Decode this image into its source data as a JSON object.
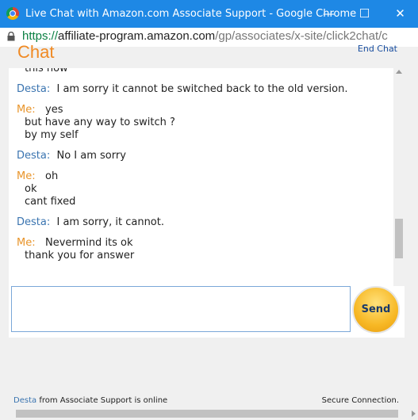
{
  "window": {
    "title": "Live Chat with Amazon.com Associate Support - Google Chrome",
    "minimize": "—",
    "maximize": "☐",
    "close": "✕"
  },
  "address": {
    "scheme": "https://",
    "domain": "affiliate-program.amazon.com",
    "path": "/gp/associates/x-site/click2chat/c"
  },
  "chat": {
    "heading": "Chat",
    "end_chat": "End Chat",
    "messages": [
      {
        "lines": [
          "this now"
        ]
      },
      {
        "sender": "Desta:",
        "lines": [
          "I am sorry it cannot be switched back to the old version."
        ]
      },
      {
        "sender": "Me:",
        "lines": [
          "yes",
          "but have any way to switch ?",
          "by my self"
        ]
      },
      {
        "sender": "Desta:",
        "lines": [
          "No I am sorry"
        ]
      },
      {
        "sender": "Me:",
        "lines": [
          "oh",
          "ok",
          "cant fixed"
        ]
      },
      {
        "sender": "Desta:",
        "lines": [
          "I am sorry, it cannot."
        ]
      },
      {
        "sender": "Me:",
        "lines": [
          "Nevermind its ok",
          "thank you for answer"
        ]
      }
    ],
    "input_value": "",
    "send_label": "Send"
  },
  "status": {
    "agent_name": "Desta",
    "online_text": "from Associate Support is online",
    "connection": "Secure Connection."
  },
  "colors": {
    "titlebar": "#1e88e5",
    "agent": "#3a74b0",
    "me": "#e8942a",
    "heading": "#f08a24"
  }
}
